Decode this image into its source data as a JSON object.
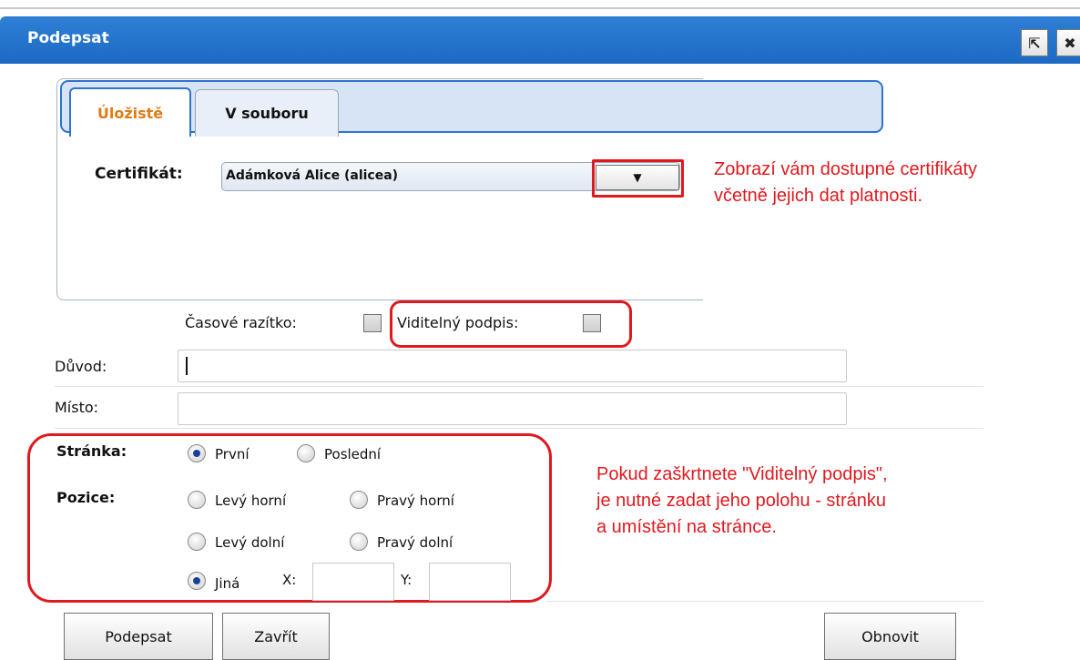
{
  "window": {
    "title": "Podepsat",
    "popout_icon": "popout-icon",
    "close_icon": "close-icon",
    "popout_glyph": "⇱",
    "close_glyph": "✖"
  },
  "tabs": [
    {
      "label": "Úložistě",
      "active": true
    },
    {
      "label": "V souboru",
      "active": false
    }
  ],
  "certificate": {
    "label": "Certifikát:",
    "value": "Adámková Alice (alicea)",
    "dropdown_glyph": "▼"
  },
  "annotations": {
    "certificate_note_line1": "Zobrazí vám dostupné certifikáty",
    "certificate_note_line2": "včetně jejich dat platnosti.",
    "position_note_line1": "Pokud zaškrtnete \"Viditelný podpis\",",
    "position_note_line2": "je nutné zadat jeho polohu - stránku",
    "position_note_line3": "a umístění na stránce.",
    "highlight_color": "#e0191f"
  },
  "options": {
    "timestamp_label": "Časové razítko:",
    "timestamp_checked": false,
    "visible_signature_label": "Viditelný podpis:",
    "visible_signature_checked": false
  },
  "fields": {
    "reason_label": "Důvod:",
    "reason_value": "",
    "place_label": "Místo:",
    "place_value": ""
  },
  "page": {
    "label": "Stránka:",
    "first_label": "První",
    "last_label": "Poslední",
    "selected": "První"
  },
  "position": {
    "label": "Pozice:",
    "top_left": "Levý horní",
    "top_right": "Pravý horní",
    "bottom_left": "Levý dolní",
    "bottom_right": "Pravý dolní",
    "other": "Jiná",
    "x_label": "X:",
    "y_label": "Y:",
    "x_value": "",
    "y_value": "",
    "selected": "Jiná"
  },
  "buttons": {
    "sign": "Podepsat",
    "close": "Zavřít",
    "refresh": "Obnovit"
  },
  "colors": {
    "titlebar": "#1c6ac3",
    "tab_active_text": "#e27b16",
    "tabstrip_bg": "#d7e4f5"
  }
}
